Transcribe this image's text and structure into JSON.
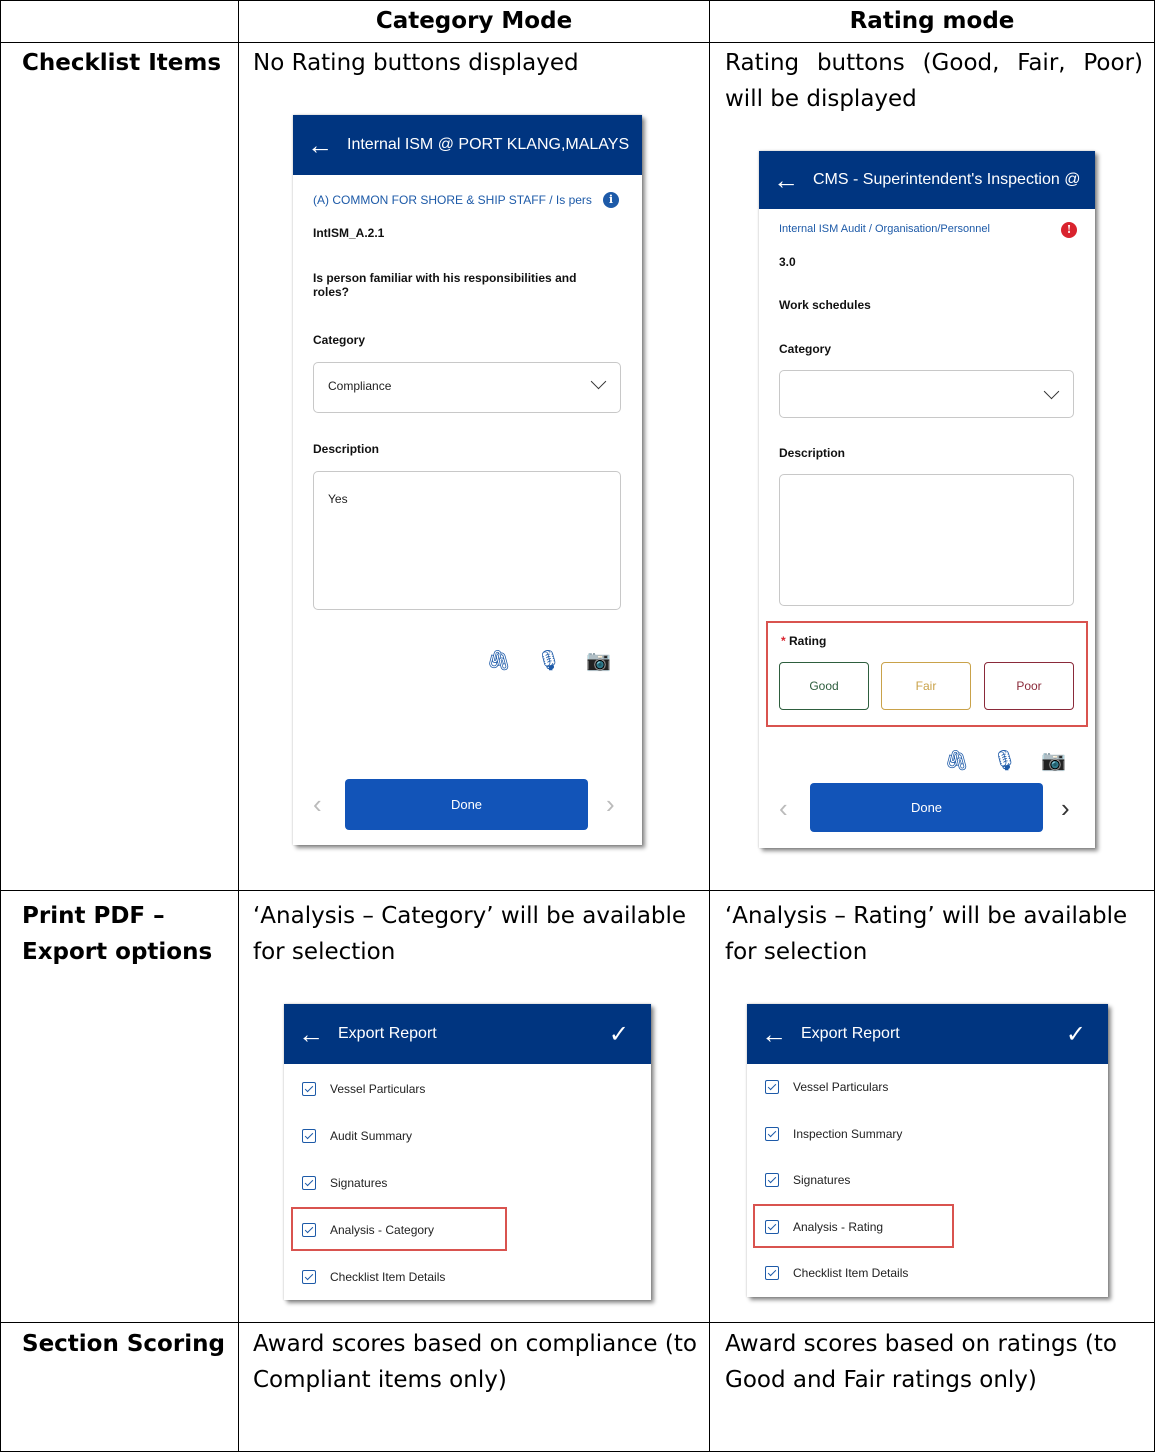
{
  "table": {
    "headers": [
      "Category Mode",
      "Rating mode"
    ],
    "rows": [
      {
        "label": "Checklist Items",
        "category_text": "No Rating buttons displayed",
        "rating_text": "Rating buttons (Good, Fair, Poor) will be displayed"
      },
      {
        "label": "Print PDF – Export options",
        "category_text": "‘Analysis – Category’ will be available for selection",
        "rating_text": "‘Analysis – Rating’ will be available for selection"
      },
      {
        "label": "Section Scoring",
        "category_text": "Award scores based on compliance (to Compliant items only)",
        "rating_text": "Award scores based on ratings (to Good and Fair ratings only)"
      }
    ]
  },
  "phone_category": {
    "title": "Internal ISM @ PORT KLANG,MALAYS",
    "breadcrumb": "(A) COMMON FOR SHORE & SHIP STAFF / Is pers",
    "item_code": "IntISM_A.2.1",
    "question": "Is person familiar with his responsibilities and roles?",
    "category_label": "Category",
    "category_value": "Compliance",
    "description_label": "Description",
    "description_value": "Yes",
    "done_label": "Done"
  },
  "phone_rating": {
    "title": "CMS - Superintendent's Inspection @",
    "breadcrumb": "Internal ISM Audit / Organisation/Personnel",
    "item_code": "3.0",
    "question": "Work schedules",
    "category_label": "Category",
    "category_value": "",
    "description_label": "Description",
    "rating_label": "Rating",
    "rating_required": "*",
    "rating_options": [
      "Good",
      "Fair",
      "Poor"
    ],
    "done_label": "Done"
  },
  "export_category": {
    "title": "Export Report",
    "items": [
      "Vessel Particulars",
      "Audit Summary",
      "Signatures",
      "Analysis - Category",
      "Checklist Item Details"
    ]
  },
  "export_rating": {
    "title": "Export Report",
    "items": [
      "Vessel Particulars",
      "Inspection Summary",
      "Signatures",
      "Analysis - Rating",
      "Checklist Item Details"
    ]
  },
  "colors": {
    "appbar": "#003580",
    "accent_blue": "#1254b8",
    "highlight_red": "#d9534f",
    "good": "#2e5e3e",
    "fair": "#c9a24a",
    "poor": "#8a2a3a"
  },
  "icons": [
    "back-arrow-icon",
    "info-icon",
    "chevron-down-icon",
    "paperclip-icon",
    "microphone-icon",
    "camera-icon",
    "chevron-left-icon",
    "chevron-right-icon",
    "checkmark-icon",
    "checkbox-icon"
  ]
}
